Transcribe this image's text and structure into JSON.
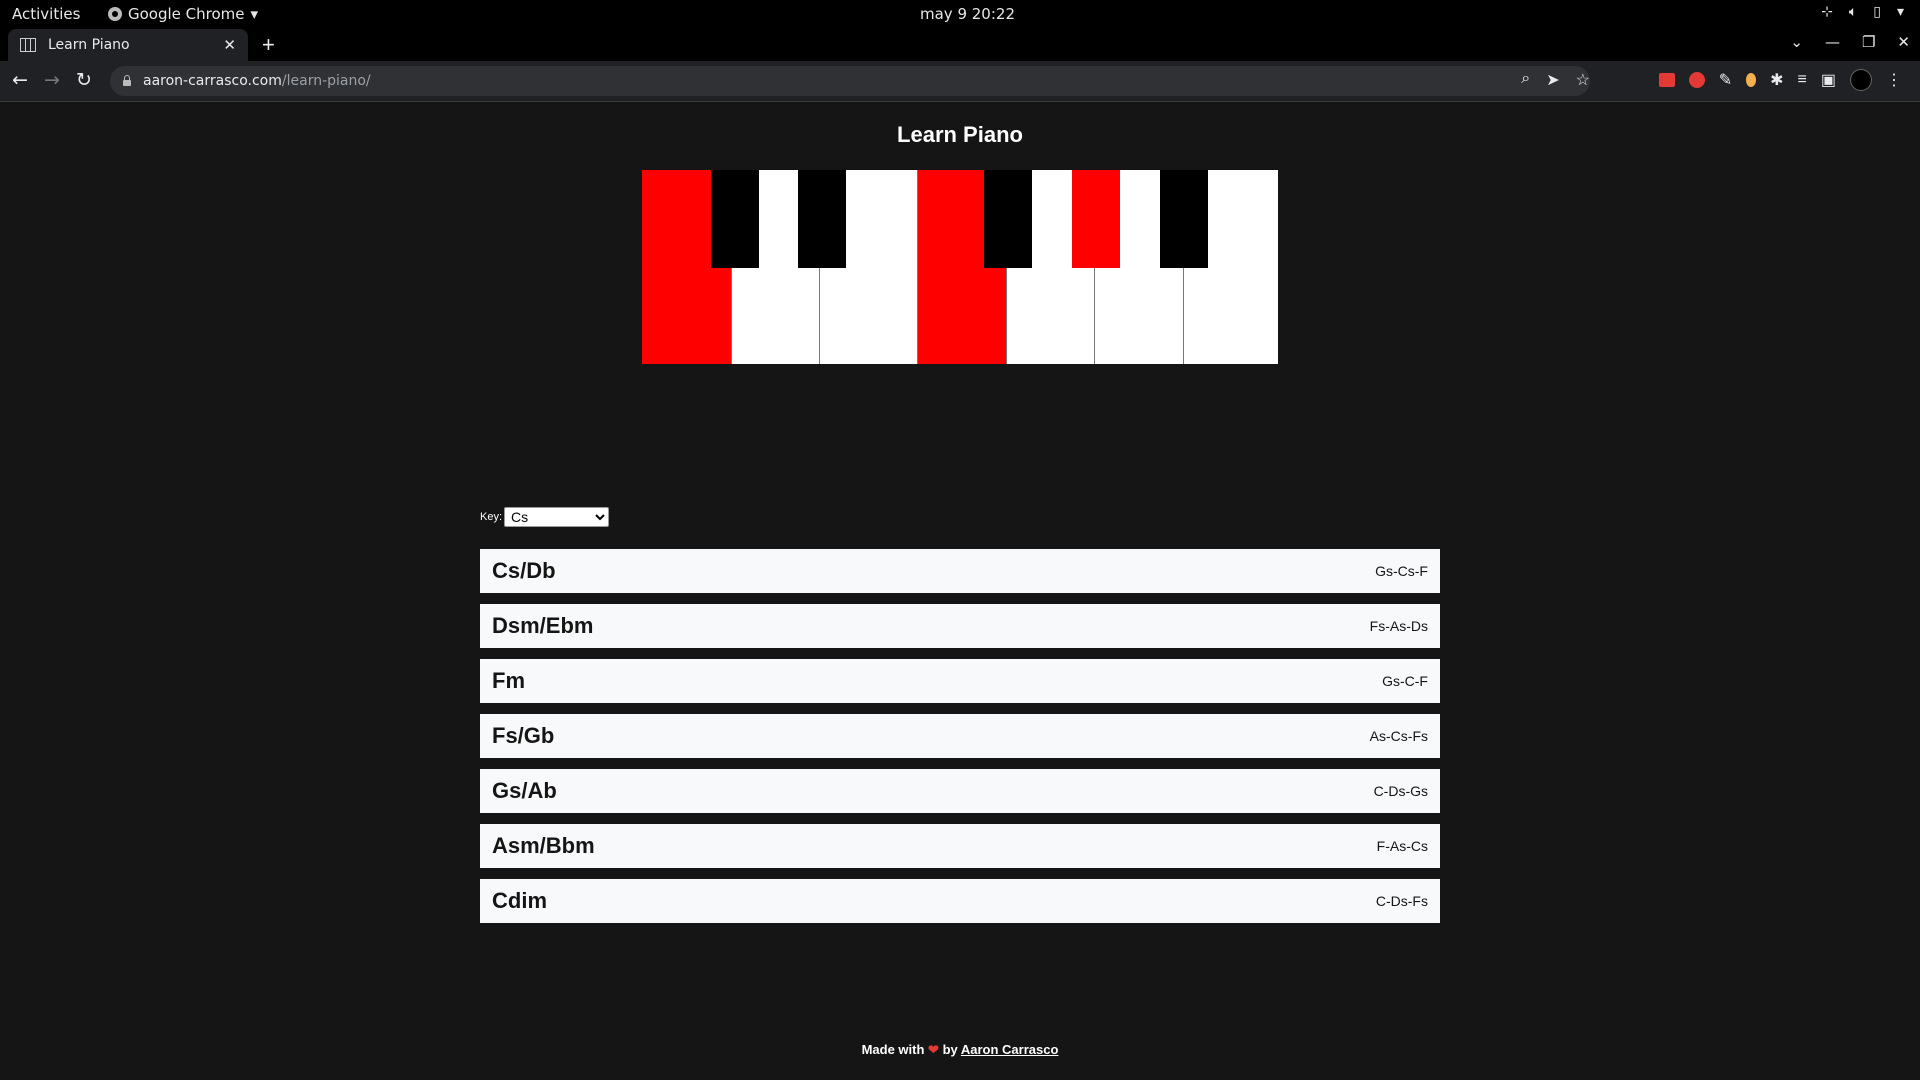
{
  "os_bar": {
    "activities": "Activities",
    "app_name": "Google Chrome",
    "clock": "may 9  20:22"
  },
  "browser": {
    "tab_title": "Learn Piano",
    "url_host": "aaron-carrasco.com",
    "url_path": "/learn-piano/"
  },
  "page": {
    "title": "Learn Piano",
    "key_label": "Key:",
    "key_selected": "Cs",
    "piano": {
      "white_keys": [
        {
          "note": "C",
          "active": true
        },
        {
          "note": "D",
          "active": false
        },
        {
          "note": "E",
          "active": false
        },
        {
          "note": "F",
          "active": true
        },
        {
          "note": "G",
          "active": false
        },
        {
          "note": "A",
          "active": false
        },
        {
          "note": "B",
          "active": false
        }
      ],
      "black_keys": [
        {
          "note": "Cs",
          "active": false
        },
        {
          "note": "Ds",
          "active": false
        },
        {
          "note": "Fs",
          "active": false
        },
        {
          "note": "Gs",
          "active": true
        },
        {
          "note": "As",
          "active": false
        }
      ]
    },
    "chords": [
      {
        "name": "Cs/Db",
        "notes": "Gs-Cs-F"
      },
      {
        "name": "Dsm/Ebm",
        "notes": "Fs-As-Ds"
      },
      {
        "name": "Fm",
        "notes": "Gs-C-F"
      },
      {
        "name": "Fs/Gb",
        "notes": "As-Cs-Fs"
      },
      {
        "name": "Gs/Ab",
        "notes": "C-Ds-Gs"
      },
      {
        "name": "Asm/Bbm",
        "notes": "F-As-Cs"
      },
      {
        "name": "Cdim",
        "notes": "C-Ds-Fs"
      }
    ],
    "footer": {
      "made_with": "Made with",
      "by": "by",
      "author": "Aaron Carrasco"
    }
  }
}
